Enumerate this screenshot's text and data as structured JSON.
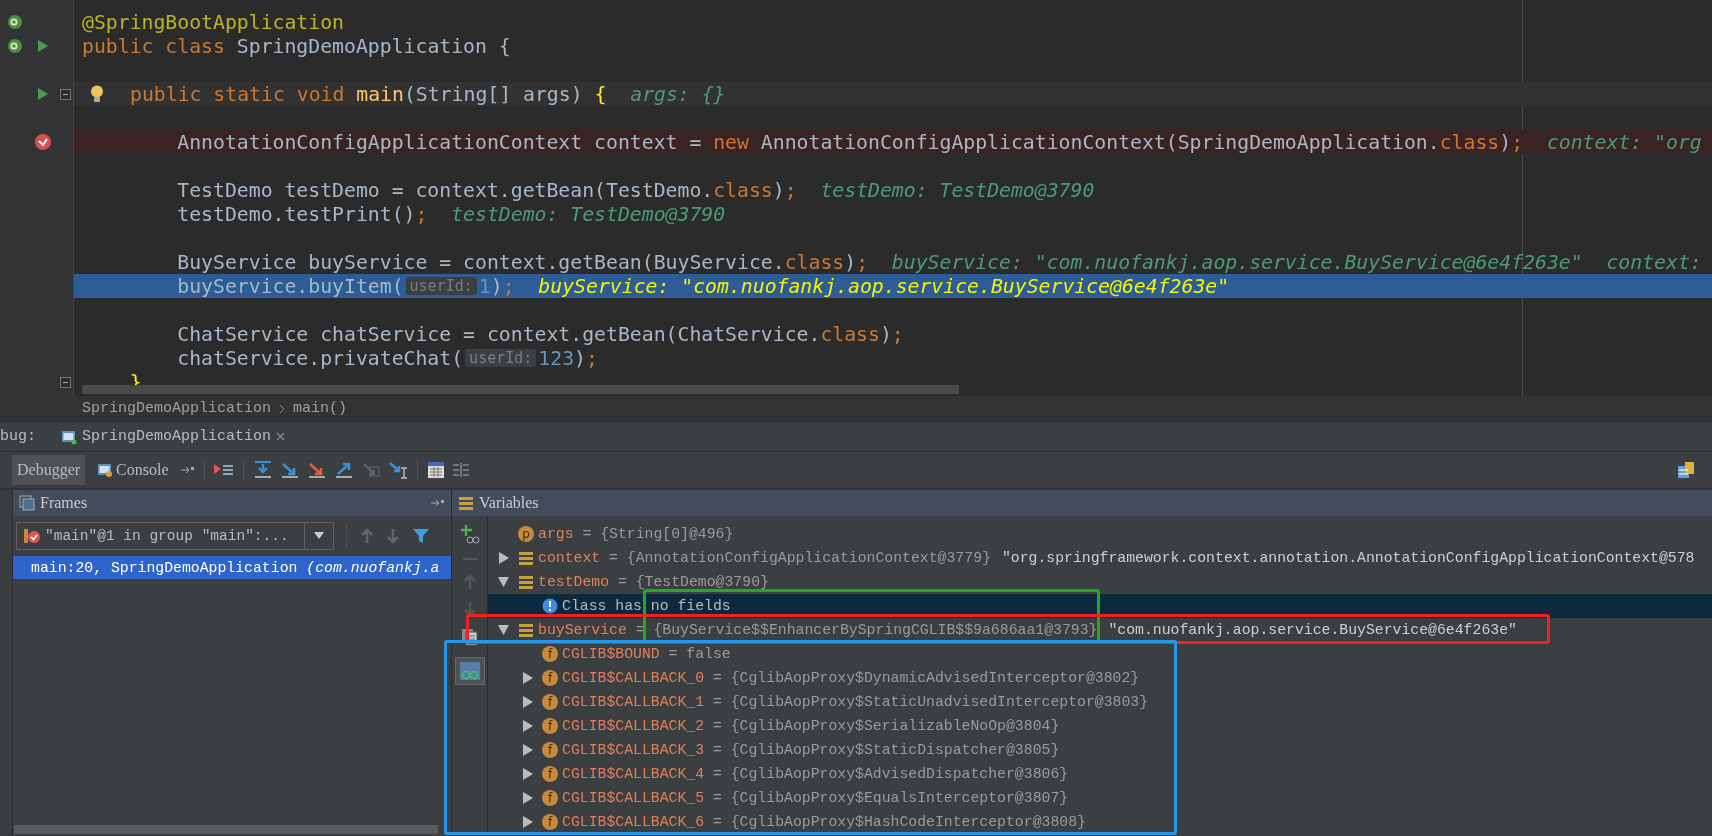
{
  "editor": {
    "lines": [
      {
        "kind": "plain",
        "marks": [
          {
            "kind": "bean"
          }
        ],
        "tokens": [
          {
            "kind": "annotation",
            "text": "@SpringBootApplication"
          }
        ]
      },
      {
        "kind": "plain",
        "marks": [
          {
            "kind": "bean"
          },
          {
            "kind": "run"
          }
        ],
        "tokens": [
          {
            "kind": "keyword",
            "text": "public class "
          },
          {
            "kind": "plain",
            "text": "SpringDemoApplication {"
          }
        ]
      },
      {
        "kind": "plain"
      },
      {
        "kind": "method",
        "marks": [
          {
            "kind": "run"
          },
          {
            "kind": "fold"
          },
          {
            "kind": "bulb"
          }
        ],
        "tokens": [
          {
            "kind": "keyword",
            "text": "public static void "
          },
          {
            "kind": "method",
            "text": "main"
          },
          {
            "kind": "plain",
            "text": "(String[] args) "
          },
          {
            "kind": "brace",
            "text": "{"
          },
          {
            "kind": "value",
            "text": "  args: {}"
          }
        ]
      },
      {
        "kind": "plain"
      },
      {
        "kind": "breakpoint",
        "marks": [
          {
            "kind": "breakpoint"
          }
        ],
        "tokens": [
          {
            "kind": "plain",
            "text": "        AnnotationConfigApplicationContext context = "
          },
          {
            "kind": "keyword",
            "text": "new"
          },
          {
            "kind": "plain",
            "text": " AnnotationConfigApplicationContext(SpringDemoApplication."
          },
          {
            "kind": "keyword",
            "text": "class"
          },
          {
            "kind": "plain",
            "text": ")"
          },
          {
            "kind": "keyword",
            "text": ";"
          },
          {
            "kind": "value",
            "text": "  context: \"org"
          }
        ]
      },
      {
        "kind": "plain"
      },
      {
        "kind": "plain",
        "tokens": [
          {
            "kind": "plain",
            "text": "        TestDemo testDemo = context.getBean(TestDemo."
          },
          {
            "kind": "keyword",
            "text": "class"
          },
          {
            "kind": "plain",
            "text": ")"
          },
          {
            "kind": "keyword",
            "text": ";"
          },
          {
            "kind": "value",
            "text": "  testDemo: TestDemo@3790"
          }
        ]
      },
      {
        "kind": "plain",
        "tokens": [
          {
            "kind": "plain",
            "text": "        testDemo.testPrint()"
          },
          {
            "kind": "keyword",
            "text": ";"
          },
          {
            "kind": "value",
            "text": "  testDemo: TestDemo@3790"
          }
        ]
      },
      {
        "kind": "plain"
      },
      {
        "kind": "plain",
        "tokens": [
          {
            "kind": "plain",
            "text": "        BuyService buyService = context.getBean(BuyService."
          },
          {
            "kind": "keyword",
            "text": "class"
          },
          {
            "kind": "plain",
            "text": ")"
          },
          {
            "kind": "keyword",
            "text": ";"
          },
          {
            "kind": "value",
            "text": "  buyService: \"com.nuofankj.aop.service.BuyService@6e4f263e\"  context:"
          }
        ]
      },
      {
        "kind": "execution",
        "tokens": [
          {
            "kind": "plain",
            "text": "        buyService.buyItem("
          },
          {
            "kind": "hint",
            "text": "userId:"
          },
          {
            "kind": "number",
            "text": "1"
          },
          {
            "kind": "plain",
            "text": ")"
          },
          {
            "kind": "keyword",
            "text": ";"
          },
          {
            "kind": "current-value",
            "text": "  buyService: \"com.nuofankj.aop.service.BuyService@6e4f263e\""
          }
        ]
      },
      {
        "kind": "plain"
      },
      {
        "kind": "plain",
        "tokens": [
          {
            "kind": "plain",
            "text": "        ChatService chatService = context.getBean(ChatService."
          },
          {
            "kind": "keyword",
            "text": "class"
          },
          {
            "kind": "plain",
            "text": ")"
          },
          {
            "kind": "keyword",
            "text": ";"
          }
        ]
      },
      {
        "kind": "plain",
        "tokens": [
          {
            "kind": "plain",
            "text": "        chatService.privateChat("
          },
          {
            "kind": "hint",
            "text": "userId:"
          },
          {
            "kind": "number",
            "text": "123"
          },
          {
            "kind": "plain",
            "text": ")"
          },
          {
            "kind": "keyword",
            "text": ";"
          }
        ]
      },
      {
        "kind": "plain",
        "marks": [
          {
            "kind": "fold"
          }
        ],
        "tokens": [
          {
            "kind": "brace",
            "text": "    }"
          }
        ]
      }
    ]
  },
  "breadcrumbs": [
    "SpringDemoApplication",
    "main()"
  ],
  "debug_panel": {
    "label": "bug:",
    "session_tab": {
      "label": "SpringDemoApplication"
    },
    "tabs": [
      {
        "label": "Debugger",
        "selected": true
      },
      {
        "label": "Console",
        "selected": false
      }
    ]
  },
  "frames": {
    "title": "Frames",
    "thread": "\"main\"@1 in group \"main\":...",
    "items": [
      {
        "text": "main:20, SpringDemoApplication *(com.nuofankj.a*",
        "selected": true
      }
    ]
  },
  "variables": {
    "title": "Variables",
    "items": [
      {
        "kind": "parameter",
        "badge": "p",
        "name": "args",
        "value": "= {String[0]@496}",
        "expandable": false,
        "selected": false
      },
      {
        "kind": "local",
        "name": "context",
        "value": "= {AnnotationConfigApplicationContext@3779}",
        "string": "\"org.springframework.context.annotation.AnnotationConfigApplicationContext@578",
        "expandable": true,
        "expanded": false,
        "selected": false
      },
      {
        "kind": "local",
        "name": "testDemo",
        "value": "= {TestDemo@3790}",
        "expandable": true,
        "expanded": true,
        "selected": false,
        "children": [
          {
            "kind": "info",
            "message": "Class has no fields",
            "expandable": false,
            "selected": true
          }
        ]
      },
      {
        "kind": "local",
        "name": "buyService",
        "value": "= {BuyService$$EnhancerBySpringCGLIB$$9a686aa1@3793}",
        "string": "\"com.nuofankj.aop.service.BuyService@6e4f263e\"",
        "expandable": true,
        "expanded": true,
        "selected": false,
        "children": [
          {
            "kind": "field",
            "badge": "f",
            "name": "CGLIB$BOUND",
            "value": "= false",
            "expandable": false,
            "selected": false
          },
          {
            "kind": "field",
            "badge": "f",
            "name": "CGLIB$CALLBACK_0",
            "value": "= {CglibAopProxy$DynamicAdvisedInterceptor@3802}",
            "expandable": true,
            "expanded": false,
            "selected": false
          },
          {
            "kind": "field",
            "badge": "f",
            "name": "CGLIB$CALLBACK_1",
            "value": "= {CglibAopProxy$StaticUnadvisedInterceptor@3803}",
            "expandable": true,
            "expanded": false,
            "selected": false
          },
          {
            "kind": "field",
            "badge": "f",
            "name": "CGLIB$CALLBACK_2",
            "value": "= {CglibAopProxy$SerializableNoOp@3804}",
            "expandable": true,
            "expanded": false,
            "selected": false
          },
          {
            "kind": "field",
            "badge": "f",
            "name": "CGLIB$CALLBACK_3",
            "value": "= {CglibAopProxy$StaticDispatcher@3805}",
            "expandable": true,
            "expanded": false,
            "selected": false
          },
          {
            "kind": "field",
            "badge": "f",
            "name": "CGLIB$CALLBACK_4",
            "value": "= {CglibAopProxy$AdvisedDispatcher@3806}",
            "expandable": true,
            "expanded": false,
            "selected": false
          },
          {
            "kind": "field",
            "badge": "f",
            "name": "CGLIB$CALLBACK_5",
            "value": "= {CglibAopProxy$EqualsInterceptor@3807}",
            "expandable": true,
            "expanded": false,
            "selected": false
          },
          {
            "kind": "field",
            "badge": "f",
            "name": "CGLIB$CALLBACK_6",
            "value": "= {CglibAopProxy$HashCodeInterceptor@3808}",
            "expandable": true,
            "expanded": false,
            "selected": false
          }
        ]
      }
    ]
  },
  "annotation_frames": [
    {
      "color": "#22aa22"
    },
    {
      "color": "#ee2222"
    },
    {
      "color": "#2299ee"
    }
  ]
}
